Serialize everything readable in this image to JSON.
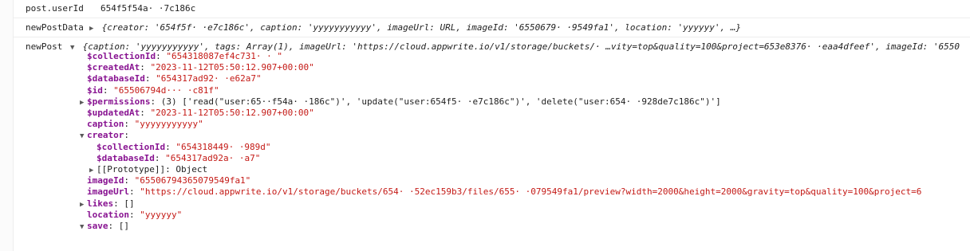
{
  "rows": {
    "userid": {
      "label": "post.userId",
      "value": "654f5f54a· ·7c186c"
    },
    "newpostdata": {
      "label": "newPostData",
      "value": "{creator: '654f5f·   ·e7c186c', caption: 'yyyyyyyyyyy', imageUrl: URL, imageId: '6550679·  ·9549fa1', location: 'yyyyyy', …}"
    },
    "newpost": {
      "label": "newPost",
      "value": "{caption: 'yyyyyyyyyyy', tags: Array(1), imageUrl: 'https://cloud.appwrite.io/v1/storage/buckets/·  …vity=top&quality=100&project=653e8376·  ·eaa4dfeef', imageId: '6550"
    }
  },
  "tree": [
    {
      "id": "collectionId",
      "indent": 1,
      "key": "$collectionId",
      "value": "\"654318087ef4c731· · \"",
      "vtype": "string",
      "expander": ""
    },
    {
      "id": "createdAt",
      "indent": 1,
      "key": "$createdAt",
      "value": "\"2023-11-12T05:50:12.907+00:00\"",
      "vtype": "string",
      "expander": ""
    },
    {
      "id": "databaseId",
      "indent": 1,
      "key": "$databaseId",
      "value": "\"654317ad92·   ·e62a7\"",
      "vtype": "string",
      "expander": ""
    },
    {
      "id": "id",
      "indent": 1,
      "key": "$id",
      "value": "\"65506794d···  ·c81f\"",
      "vtype": "string",
      "expander": ""
    },
    {
      "id": "permissions",
      "indent": 1,
      "key": "$permissions",
      "value": "(3) ['read(\"user:65··f54a·  ·186c\")', 'update(\"user:654f5·  ·e7c186c\")', 'delete(\"user:654·  ·928de7c186c\")']",
      "vtype": "plain",
      "expander": "▶"
    },
    {
      "id": "updatedAt",
      "indent": 1,
      "key": "$updatedAt",
      "value": "\"2023-11-12T05:50:12.907+00:00\"",
      "vtype": "string",
      "expander": ""
    },
    {
      "id": "caption",
      "indent": 1,
      "key": "caption",
      "value": "\"yyyyyyyyyyy\"",
      "vtype": "string",
      "expander": ""
    },
    {
      "id": "creator",
      "indent": 1,
      "key": "creator",
      "value": "",
      "vtype": "plain",
      "expander": "▼"
    },
    {
      "id": "creator-collectionId",
      "indent": 2,
      "key": "$collectionId",
      "value": "\"654318449·   ·989d\"",
      "vtype": "string",
      "expander": ""
    },
    {
      "id": "creator-databaseId",
      "indent": 2,
      "key": "$databaseId",
      "value": "\"654317ad92a·   ·a7\"",
      "vtype": "string",
      "expander": ""
    },
    {
      "id": "prototype",
      "indent": 2,
      "key": "[[Prototype]]",
      "value": "Object",
      "vtype": "plain",
      "expander": "▶",
      "keyplain": true
    },
    {
      "id": "imageId",
      "indent": 1,
      "key": "imageId",
      "value": "\"65506794365079549fa1\"",
      "vtype": "string",
      "expander": ""
    },
    {
      "id": "imageUrl",
      "indent": 1,
      "key": "imageUrl",
      "value": "\"https://cloud.appwrite.io/v1/storage/buckets/654·    ·52ec159b3/files/655·  ·079549fa1/preview?width=2000&height=2000&gravity=top&quality=100&project=6",
      "vtype": "string",
      "expander": ""
    },
    {
      "id": "likes",
      "indent": 1,
      "key": "likes",
      "value": "[]",
      "vtype": "plain",
      "expander": "▶"
    },
    {
      "id": "location",
      "indent": 1,
      "key": "location",
      "value": "\"yyyyyy\"",
      "vtype": "string",
      "expander": ""
    },
    {
      "id": "saves",
      "indent": 1,
      "key": "save",
      "value": "[]",
      "vtype": "plain",
      "expander": "▼"
    }
  ],
  "colors": {
    "key": "#881391",
    "string": "#c41a16",
    "text": "#1f1f1f",
    "border": "#eeeeee"
  }
}
